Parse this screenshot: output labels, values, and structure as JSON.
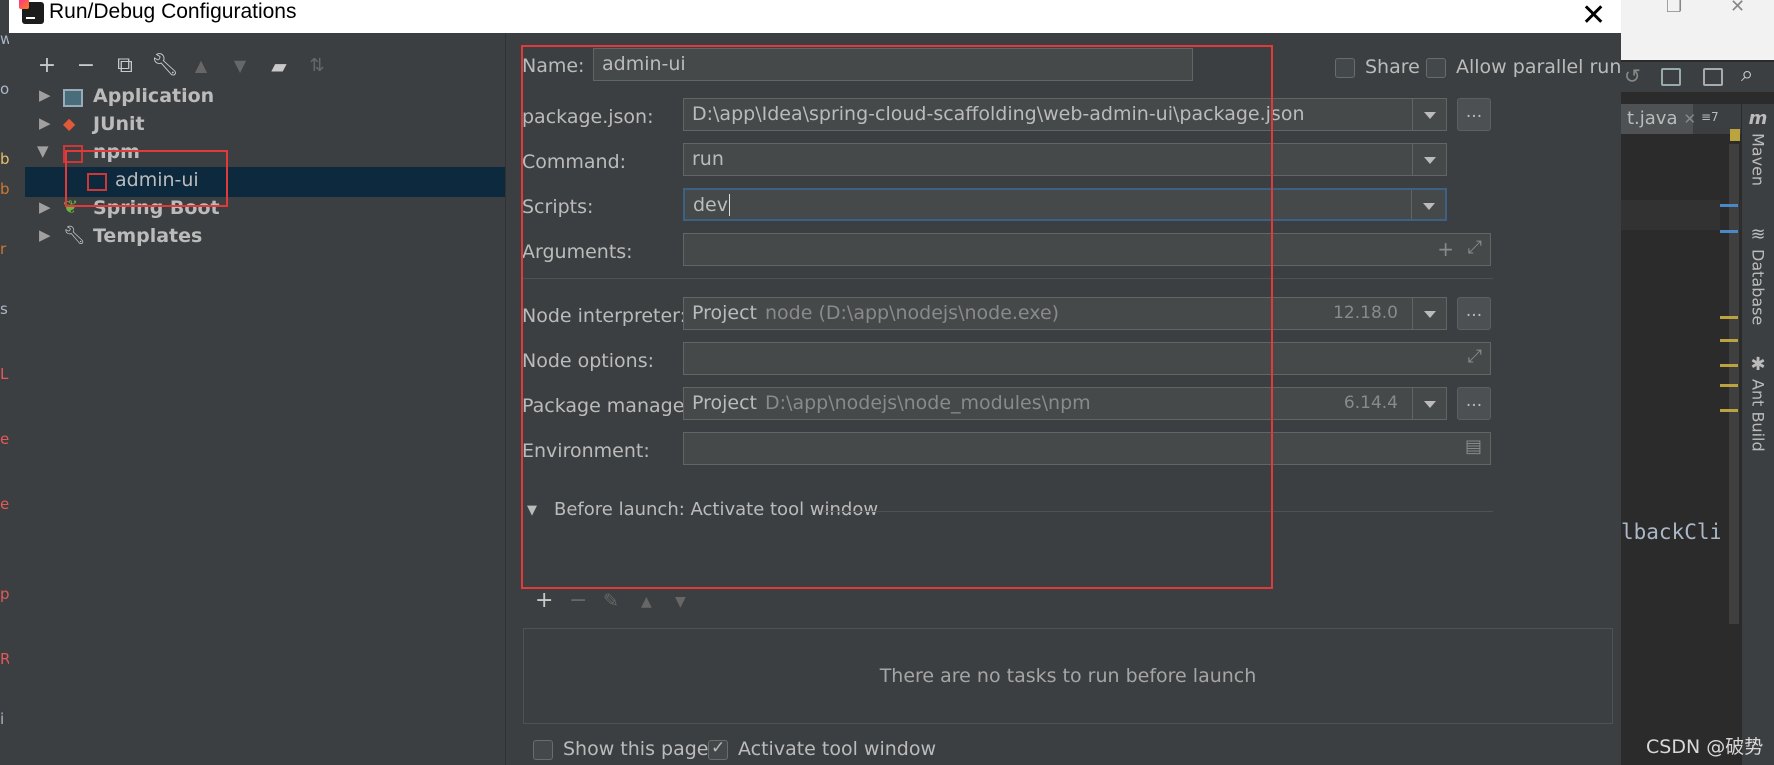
{
  "window": {
    "title": "Run/Debug Configurations"
  },
  "tree_toolbar": {
    "add": "+",
    "remove": "−"
  },
  "tree": [
    {
      "label": "Application",
      "expanded": false
    },
    {
      "label": "JUnit",
      "expanded": false
    },
    {
      "label": "npm",
      "expanded": true
    },
    {
      "label": "admin-ui",
      "selected": true
    },
    {
      "label": "Spring Boot",
      "expanded": false
    },
    {
      "label": "Templates",
      "expanded": false
    }
  ],
  "form": {
    "name_label": "Name:",
    "name_value": "admin-ui",
    "share_label": "Share",
    "share_checked": false,
    "parallel_label": "Allow parallel run",
    "parallel_checked": false,
    "package_json_label": "package.json:",
    "package_json_value": "D:\\app\\Idea\\spring-cloud-scaffolding\\web-admin-ui\\package.json",
    "command_label": "Command:",
    "command_value": "run",
    "scripts_label": "Scripts:",
    "scripts_value": "dev",
    "arguments_label": "Arguments:",
    "arguments_value": "",
    "node_interpreter_label": "Node interpreter:",
    "node_interpreter_main": "Project",
    "node_interpreter_path": "node (D:\\app\\nodejs\\node.exe)",
    "node_interpreter_version": "12.18.0",
    "node_options_label": "Node options:",
    "node_options_value": "",
    "package_manager_label": "Package manager:",
    "package_manager_main": "Project",
    "package_manager_path": "D:\\app\\nodejs\\node_modules\\npm",
    "package_manager_version": "6.14.4",
    "environment_label": "Environment:",
    "environment_value": "",
    "browse_label": "..."
  },
  "before_launch": {
    "header": "Before launch: Activate tool window",
    "empty_text": "There are no tasks to run before launch",
    "add": "+",
    "remove": "−"
  },
  "footer": {
    "show_page_label": "Show this page",
    "show_page_checked": false,
    "activate_label": "Activate tool window",
    "activate_checked": true
  },
  "ide": {
    "tab_label": "t.java",
    "tab_more": "≡7",
    "code_fragment": "lbackClie",
    "sidebar": [
      "Maven",
      "Database",
      "Ant Build"
    ],
    "watermark": "CSDN @破势"
  },
  "colors": {
    "highlight_box": "#e03a3a",
    "selection": "#0d293e",
    "dialog_bg": "#3c3f41",
    "field_bg": "#45494a",
    "focus_border": "#3d6185"
  }
}
